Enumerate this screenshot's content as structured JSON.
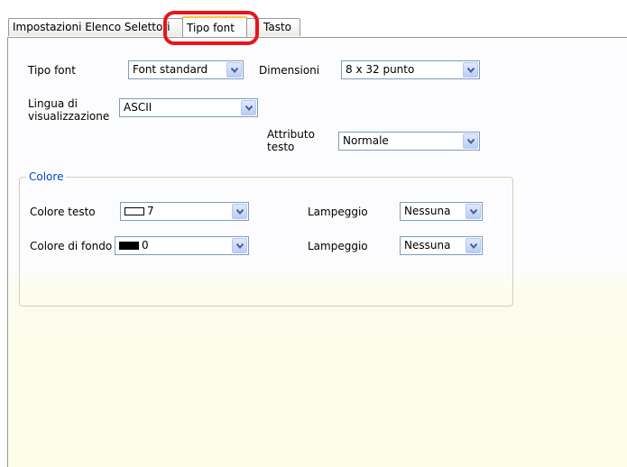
{
  "tabs": [
    {
      "label": "Impostazioni Elenco Selettori"
    },
    {
      "label": "Tipo font"
    },
    {
      "label": "Tasto"
    }
  ],
  "form": {
    "font_type_label": "Tipo font",
    "font_type_value": "Font standard",
    "size_label": "Dimensioni",
    "size_value": "8 x 32 punto",
    "language_label_line1": "Lingua di",
    "language_label_line2": "visualizzazione",
    "language_value": "ASCII",
    "text_attr_label_line1": "Attributo",
    "text_attr_label_line2": "testo",
    "text_attr_value": "Normale"
  },
  "color_group": {
    "title": "Colore",
    "text_color_label": "Colore testo",
    "text_color_value": "7",
    "text_color_swatch": "#ffffff",
    "blink1_label": "Lampeggio",
    "blink1_value": "Nessuna",
    "bg_color_label": "Colore di fondo",
    "bg_color_value": "0",
    "bg_color_swatch": "#000000",
    "blink2_label": "Lampeggio",
    "blink2_value": "Nessuna"
  },
  "colors": {
    "highlight": "#e8141c",
    "group_title": "#0046d5",
    "combo_border": "#7f9db9"
  }
}
